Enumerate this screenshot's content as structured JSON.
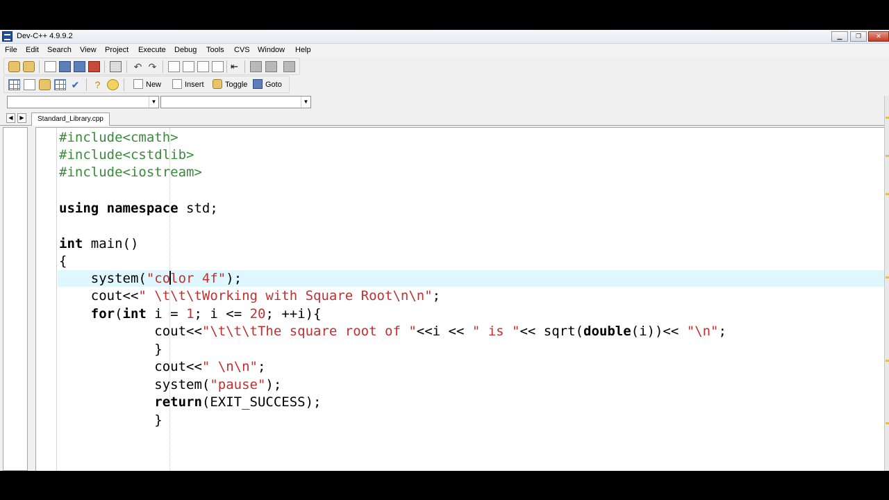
{
  "window": {
    "title": "Dev-C++ 4.9.9.2",
    "controls": [
      "minimize-icon",
      "maximize-icon",
      "close-icon"
    ]
  },
  "menu": {
    "items": [
      "File",
      "Edit",
      "Search",
      "View",
      "Project",
      "Execute",
      "Debug",
      "Tools",
      "CVS",
      "Window",
      "Help"
    ]
  },
  "toolbar2": {
    "new_label": "New",
    "insert_label": "Insert",
    "toggle_label": "Toggle",
    "goto_label": "Goto"
  },
  "combos": {
    "class_value": "",
    "member_value": ""
  },
  "tabs": {
    "active_file": "Standard_Library.cpp"
  },
  "code": {
    "l1": "#include<cmath>",
    "l2": "#include<cstdlib>",
    "l3": "#include<iostream>",
    "l5_kw": "using namespace",
    "l5_rest": " std;",
    "l7_kw": "int",
    "l7_rest": " main()",
    "l8": "{",
    "l9_a": "    system(",
    "l9_s1": "\"co",
    "l9_s2": "lor 4f\"",
    "l9_b": ");",
    "l10_a": "    cout<<",
    "l10_s": "\" \\t\\t\\tWorking with Square Root\\n\\n\"",
    "l10_b": ";",
    "l11_kw1": "    for",
    "l11_a": "(",
    "l11_kw2": "int",
    "l11_b": " i = ",
    "l11_n1": "1",
    "l11_c": "; i <= ",
    "l11_n2": "20",
    "l11_d": "; ++i){",
    "l12_a": "            cout<<",
    "l12_s1": "\"\\t\\t\\tThe square root of \"",
    "l12_b": "<<i << ",
    "l12_s2": "\" is \"",
    "l12_c": "<< sqrt(",
    "l12_kw": "double",
    "l12_d": "(i))<< ",
    "l12_s3": "\"\\n\"",
    "l12_e": ";",
    "l13": "            }",
    "l14_a": "            cout<<",
    "l14_s": "\" \\n\\n\"",
    "l14_b": ";",
    "l15_a": "            system(",
    "l15_s": "\"pause\"",
    "l15_b": ");",
    "l16_kw": "            return",
    "l16_rest": "(EXIT_SUCCESS);",
    "l17": "            }"
  },
  "colors": {
    "preprocessor": "#3a8a3a",
    "string": "#c03030",
    "current_line": "#dff7ff"
  }
}
